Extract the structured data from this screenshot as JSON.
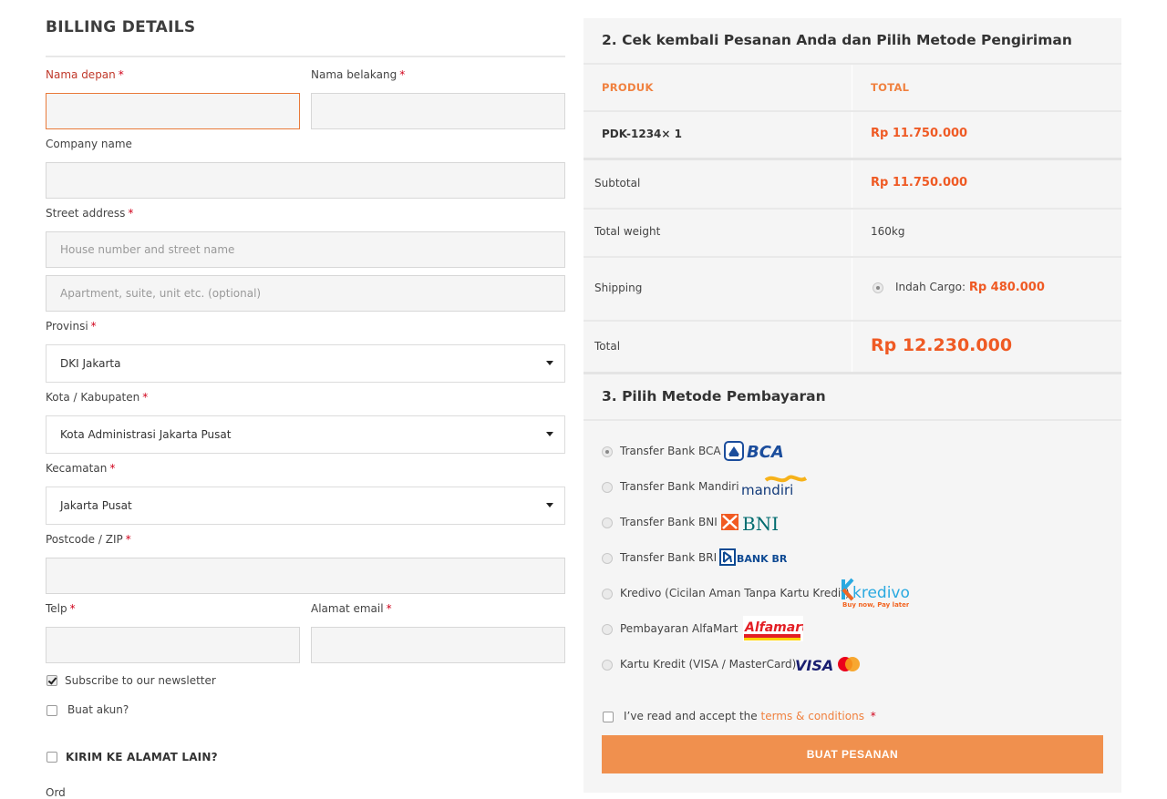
{
  "billing": {
    "title": "BILLING DETAILS",
    "req_marker": "*",
    "first_name_label": "Nama depan",
    "last_name_label": "Nama belakang",
    "company_label": "Company name",
    "street_label": "Street address",
    "street_placeholder_1": "House number and street name",
    "street_placeholder_2": "Apartment, suite, unit etc. (optional)",
    "province_label": "Provinsi",
    "province_value": "DKI Jakarta",
    "city_label": "Kota / Kabupaten",
    "city_value": "Kota Administrasi Jakarta Pusat",
    "district_label": "Kecamatan",
    "district_value": "Jakarta Pusat",
    "postcode_label": "Postcode / ZIP",
    "phone_label": "Telp",
    "email_label": "Alamat email",
    "newsletter_label": "Subscribe to our newsletter",
    "newsletter_checked": true,
    "create_account_label": "Buat akun?",
    "ship_other_label": "KIRIM KE ALAMAT LAIN?",
    "cut_label": "Ord"
  },
  "order": {
    "title": "2. Cek kembali Pesanan Anda dan Pilih Metode Pengiriman",
    "col_product": "PRODUK",
    "col_total": "TOTAL",
    "item_name": "PDK-1234× 1",
    "item_total": "Rp 11.750.000",
    "subtotal_label": "Subtotal",
    "subtotal_value": "Rp 11.750.000",
    "weight_label": "Total weight",
    "weight_value": "160kg",
    "shipping_label": "Shipping",
    "shipping_method": "Indah Cargo:",
    "shipping_price": "Rp 480.000",
    "total_label": "Total",
    "total_value": "Rp 12.230.000"
  },
  "payment": {
    "title": "3. Pilih Metode Pembayaran",
    "methods": [
      {
        "label": "Transfer Bank BCA",
        "logo": "BCA",
        "selected": true
      },
      {
        "label": "Transfer Bank Mandiri",
        "logo": "mandiri",
        "selected": false
      },
      {
        "label": "Transfer Bank BNI",
        "logo": "BNI",
        "selected": false
      },
      {
        "label": "Transfer Bank BRI",
        "logo": "BANK BRI",
        "selected": false
      },
      {
        "label": "Kredivo (Cicilan Aman Tanpa Kartu Kredit)",
        "logo": "kredivo",
        "logo_tagline": "Buy now, Pay later",
        "selected": false
      },
      {
        "label": "Pembayaran AlfaMart",
        "logo": "Alfamart",
        "selected": false
      },
      {
        "label": "Kartu Kredit (VISA / MasterCard)",
        "logo": "VISA",
        "selected": false
      }
    ],
    "terms_prefix": "I’ve read and accept the",
    "terms_link": "terms & conditions",
    "place_order": "BUAT PESANAN"
  },
  "colors": {
    "accent": "#f0904e",
    "price": "#ef5a24",
    "bca_blue": "#1b4d9c",
    "bni_teal": "#006c6f",
    "bni_orange": "#f15a22"
  }
}
